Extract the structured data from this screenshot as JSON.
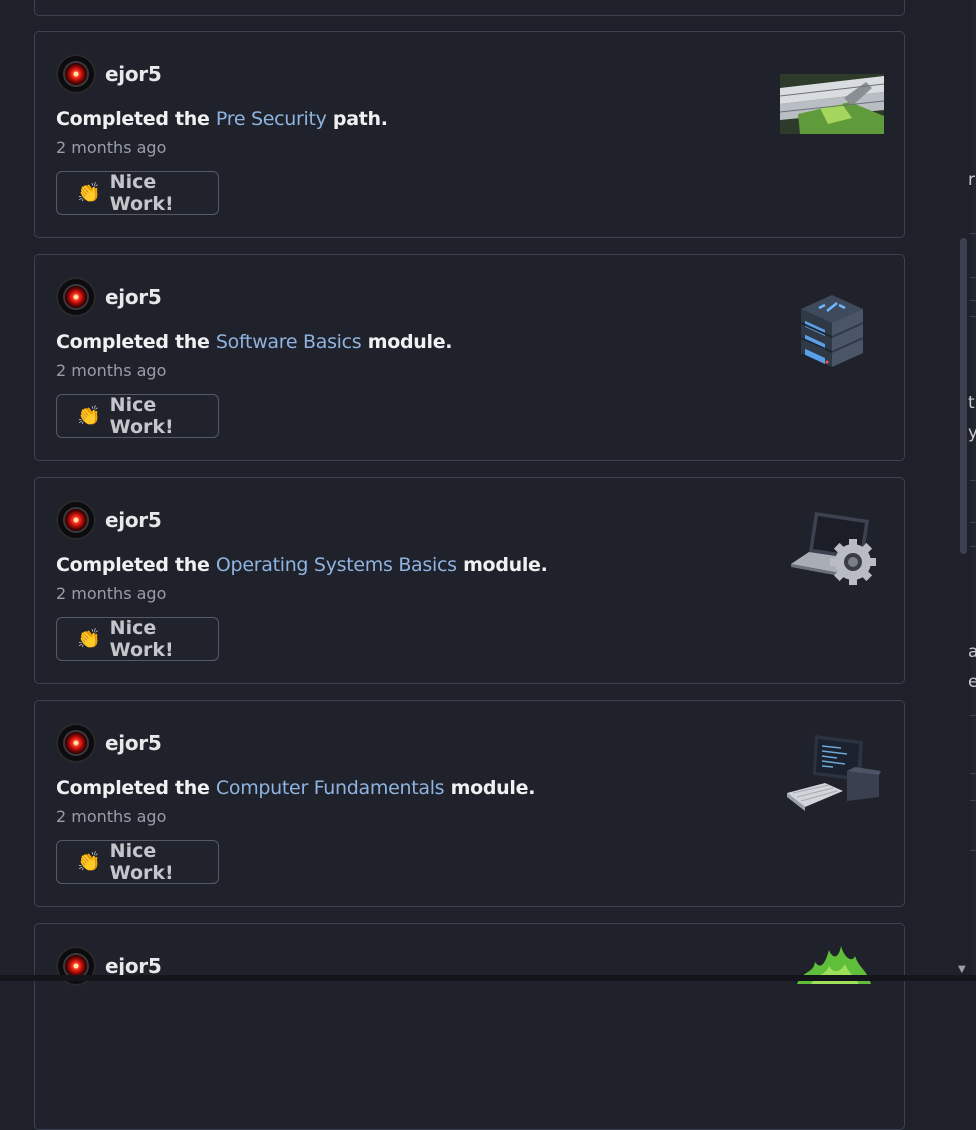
{
  "feed": {
    "items": [
      {
        "username": "ejor5",
        "prefix": "Completed the",
        "link": "Pre Security",
        "suffix": "path.",
        "time": "2 months ago",
        "button": "Nice Work!",
        "icon": "pre-security-path-icon"
      },
      {
        "username": "ejor5",
        "prefix": "Completed the",
        "link": "Software Basics",
        "suffix": "module.",
        "time": "2 months ago",
        "button": "Nice Work!",
        "icon": "server-stack-icon"
      },
      {
        "username": "ejor5",
        "prefix": "Completed the",
        "link": "Operating Systems Basics",
        "suffix": "module.",
        "time": "2 months ago",
        "button": "Nice Work!",
        "icon": "laptop-gear-icon"
      },
      {
        "username": "ejor5",
        "prefix": "Completed the",
        "link": "Computer Fundamentals",
        "suffix": "module.",
        "time": "2 months ago",
        "button": "Nice Work!",
        "icon": "desktop-computer-icon"
      },
      {
        "username": "ejor5",
        "icon": "green-flame-icon"
      }
    ]
  },
  "right_edge": {
    "chars": [
      "r",
      "t",
      "y",
      "a",
      "e"
    ]
  },
  "colors": {
    "background": "#1f212a",
    "link": "#8fb3e0",
    "border": "#3d4150"
  }
}
